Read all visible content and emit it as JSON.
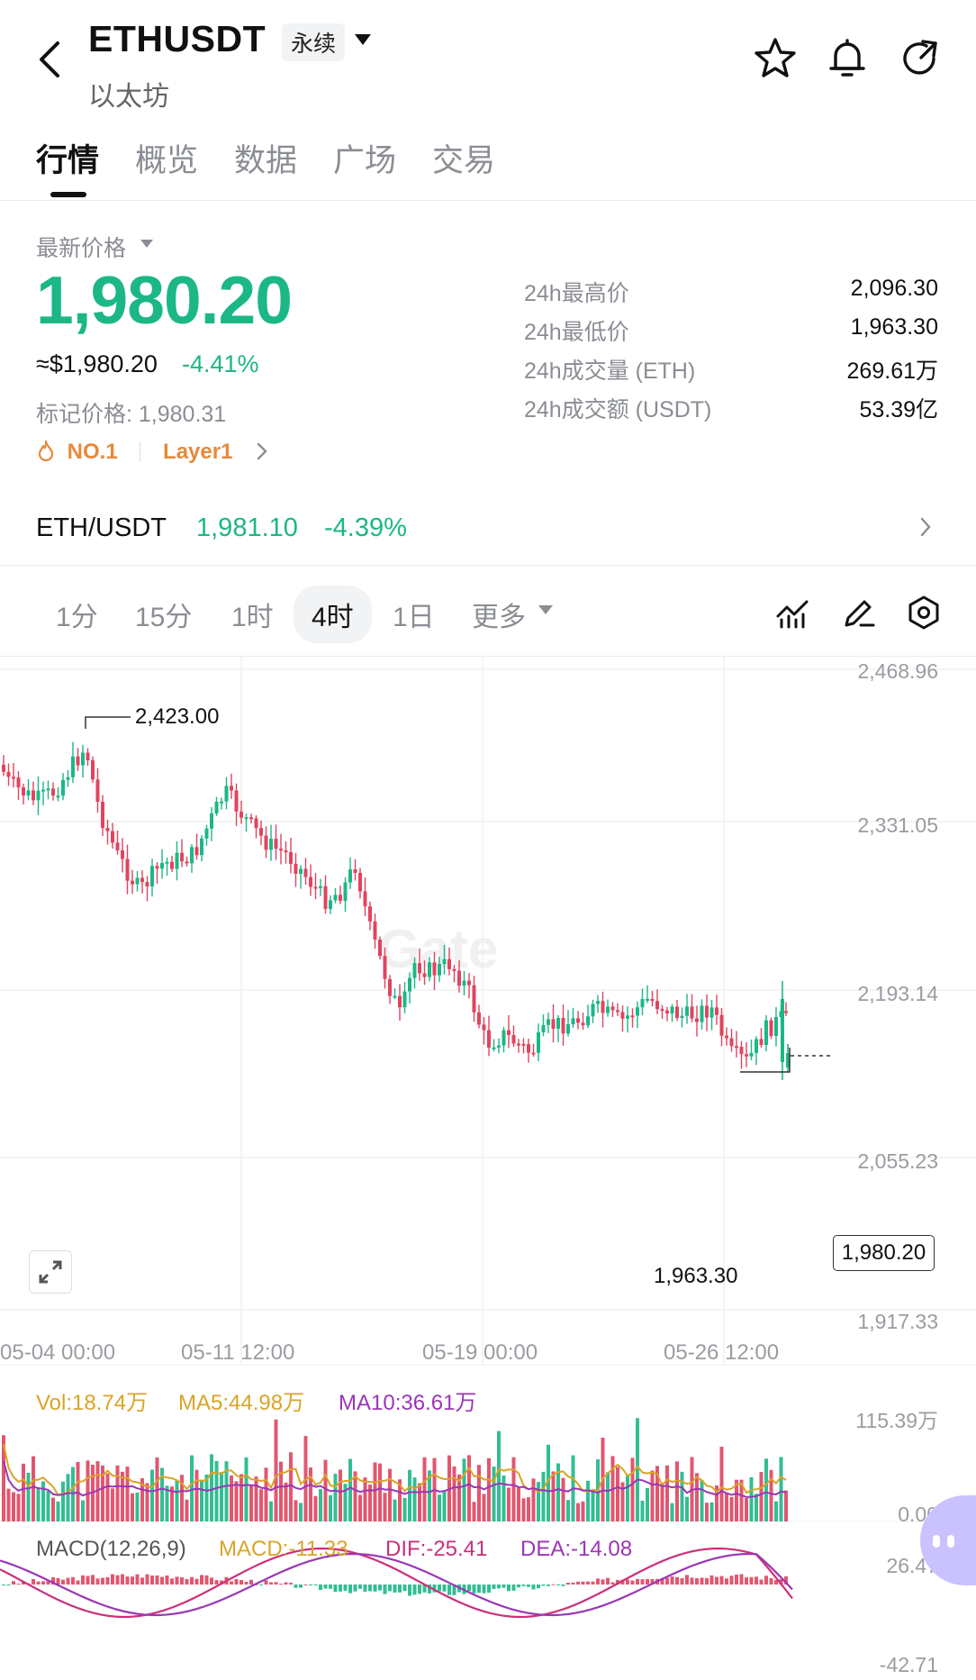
{
  "header": {
    "symbol": "ETHUSDT",
    "badge": "永续",
    "subtitle": "以太坊",
    "icons": [
      "back-icon",
      "star-icon",
      "bell-icon",
      "share-icon"
    ]
  },
  "tabs": [
    "行情",
    "概览",
    "数据",
    "广场",
    "交易"
  ],
  "price": {
    "label": "最新价格",
    "last": "1,980.20",
    "usd": "≈$1,980.20",
    "change": "-4.41%",
    "mark": "标记价格: 1,980.31",
    "tag1": "NO.1",
    "tag2": "Layer1"
  },
  "stats": [
    {
      "label": "24h最高价",
      "value": "2,096.30"
    },
    {
      "label": "24h最低价",
      "value": "1,963.30"
    },
    {
      "label": "24h成交量 (ETH)",
      "value": "269.61万"
    },
    {
      "label": "24h成交额 (USDT)",
      "value": "53.39亿"
    }
  ],
  "spot": {
    "pair": "ETH/USDT",
    "price": "1,981.10",
    "change": "-4.39%"
  },
  "intervals": {
    "items": [
      "1分",
      "15分",
      "1时",
      "4时",
      "1日"
    ],
    "more": "更多",
    "active": "4时"
  },
  "chart": {
    "y_ticks": [
      "2,468.96",
      "2,331.05",
      "2,193.14",
      "2,055.23",
      "1,917.33"
    ],
    "x_ticks": [
      "05-04 00:00",
      "05-11 12:00",
      "05-19 00:00",
      "05-26 12:00"
    ],
    "high_label": "2,423.00",
    "low_label": "1,963.30",
    "current": "1,980.20",
    "colors": {
      "up": "#1cb787",
      "down": "#e0445f"
    }
  },
  "volume": {
    "vol": "Vol:18.74万",
    "ma5": "MA5:44.98万",
    "ma10": "MA10:36.61万",
    "top": "115.39万",
    "bottom": "0.00"
  },
  "macd": {
    "label": "MACD(12,26,9)",
    "macd": "MACD:-11.33",
    "dif": "DIF:-25.41",
    "dea": "DEA:-14.08",
    "top": "26.47",
    "bottom": "-42.71"
  }
}
